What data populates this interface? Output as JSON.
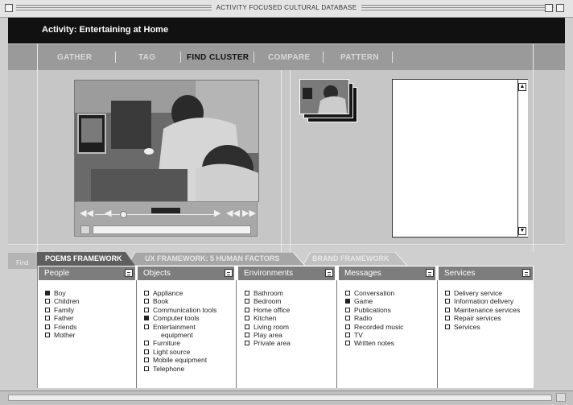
{
  "window": {
    "title": "ACTIVITY FOCUSED CULTURAL DATABASE"
  },
  "header": {
    "activity_title": "Activity: Entertaining at Home"
  },
  "nav": {
    "tabs": [
      "GATHER",
      "TAG",
      "FIND",
      "CLUSTER",
      "COMPARE",
      "PATTERN"
    ],
    "active": "FIND"
  },
  "left_tab": {
    "label": "Find"
  },
  "frameworks": {
    "tabs": [
      "POEMS FRAMEWORK",
      "UX FRAMEWORK: 5 HUMAN FACTORS",
      "BRAND FRAMEWORK"
    ],
    "active": "POEMS FRAMEWORK"
  },
  "columns": [
    {
      "header": "People",
      "items": [
        {
          "label": "Boy",
          "checked": true
        },
        {
          "label": "Children",
          "checked": false
        },
        {
          "label": "Family",
          "checked": false
        },
        {
          "label": "Father",
          "checked": false
        },
        {
          "label": "Friends",
          "checked": false
        },
        {
          "label": "Mother",
          "checked": false
        }
      ]
    },
    {
      "header": "Objects",
      "items": [
        {
          "label": "Appliance",
          "checked": false
        },
        {
          "label": "Book",
          "checked": false
        },
        {
          "label": "Communication tools",
          "checked": false
        },
        {
          "label": "Computer tools",
          "checked": true
        },
        {
          "label": "Entertainment",
          "checked": false
        },
        {
          "label": "equipment",
          "continuation": true
        },
        {
          "label": "Furniture",
          "checked": false
        },
        {
          "label": "Light source",
          "checked": false
        },
        {
          "label": "Mobile equipment",
          "checked": false
        },
        {
          "label": "Telephone",
          "checked": false
        }
      ]
    },
    {
      "header": "Environments",
      "items": [
        {
          "label": "Bathroom",
          "checked": false
        },
        {
          "label": "Bedroom",
          "checked": false
        },
        {
          "label": "Home office",
          "checked": false
        },
        {
          "label": "Kitchen",
          "checked": false
        },
        {
          "label": "Living room",
          "checked": false
        },
        {
          "label": "Play area",
          "checked": false
        },
        {
          "label": "Private area",
          "checked": false
        }
      ]
    },
    {
      "header": "Messages",
      "items": [
        {
          "label": "Conversation",
          "checked": false
        },
        {
          "label": "Game",
          "checked": true
        },
        {
          "label": "Publications",
          "checked": false
        },
        {
          "label": "Radio",
          "checked": false
        },
        {
          "label": "Recorded music",
          "checked": false
        },
        {
          "label": "TV",
          "checked": false
        },
        {
          "label": "Written notes",
          "checked": false
        }
      ]
    },
    {
      "header": "Services",
      "items": [
        {
          "label": "Delivery service",
          "checked": false
        },
        {
          "label": "Information delivery",
          "checked": false
        },
        {
          "label": "Maintenance services",
          "checked": false
        },
        {
          "label": "Repair services",
          "checked": false
        },
        {
          "label": "Services",
          "checked": false
        }
      ]
    }
  ],
  "colors": {
    "header_bg": "#111111",
    "nav_bg": "#9a9a9a",
    "column_header_bg": "#7d7d7d",
    "active_tab_bg": "#5e5e5e"
  }
}
